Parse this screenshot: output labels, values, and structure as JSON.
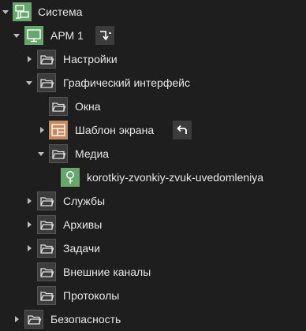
{
  "tree": {
    "system": "Система",
    "arm": "АРМ 1",
    "settings": "Настройки",
    "gui": "Графический интерфейс",
    "windows": "Окна",
    "screen_template": "Шаблон экрана",
    "media": "Медиа",
    "sound_file": "korotkiy-zvonkiy-zvuk-uvedomleniya",
    "services": "Службы",
    "archives": "Архивы",
    "tasks": "Задачи",
    "external_channels": "Внешние каналы",
    "protocols": "Протоколы",
    "security": "Безопасность"
  },
  "icons": {
    "system": "computer-network-icon",
    "arm": "monitor-icon",
    "folder": "folder-icon",
    "screen_template": "layout-grid-icon",
    "sound_file": "sound-pin-icon",
    "arm_action": "arrow-down-right-icon",
    "undo_action": "undo-arrow-icon"
  },
  "colors": {
    "background": "#1e1e1e",
    "text": "#e6e6e6",
    "green_node": "#66a86b",
    "orange_node": "#c8895a",
    "folder_bg": "#3c3c3c"
  }
}
